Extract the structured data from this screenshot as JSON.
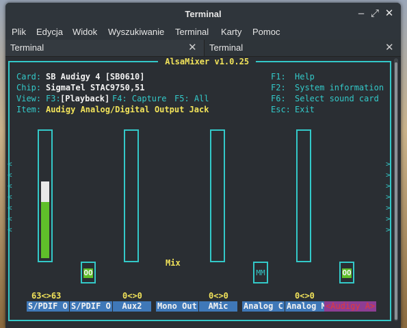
{
  "window": {
    "title": "Terminal",
    "buttons": {
      "minimize": "minimize-icon",
      "maximize": "maximize-icon",
      "close": "close-icon"
    }
  },
  "menu": [
    "Plik",
    "Edycja",
    "Widok",
    "Wyszukiwanie",
    "Terminal",
    "Karty",
    "Pomoc"
  ],
  "tabs": [
    {
      "label": "Terminal"
    },
    {
      "label": "Terminal"
    }
  ],
  "alsa": {
    "title": " AlsaMixer v1.0.25 ",
    "card_label": "Card:",
    "card_value": "SB Audigy 4 [SB0610]",
    "chip_label": "Chip:",
    "chip_value": "SigmaTel STAC9750,51",
    "view_label": "View:",
    "view_f3": "F3:",
    "view_playback": "[Playback]",
    "view_f4": "F4: Capture",
    "view_f5": "F5: All",
    "item_label": "Item:",
    "item_value": "Audigy Analog/Digital Output Jack",
    "help": [
      {
        "key": "F1:",
        "text": "Help"
      },
      {
        "key": "F2:",
        "text": "System information"
      },
      {
        "key": "F6:",
        "text": "Select sound card"
      },
      {
        "key": "Esc:",
        "text": "Exit"
      }
    ],
    "mix_label": "Mix",
    "levels": [
      "63<>63",
      "0<>0",
      "0<>0",
      "0<>0"
    ],
    "switch_on": "OO",
    "switch_mute": "MM",
    "channels": [
      "S/PDIF O",
      "S/PDIF O",
      "Aux2",
      "Mono Out",
      "AMic",
      "Analog C",
      "Analog M",
      "<Audigy A>"
    ],
    "arrow_left": "<",
    "arrow_right": ">",
    "volume_level_fraction": 0.35
  }
}
